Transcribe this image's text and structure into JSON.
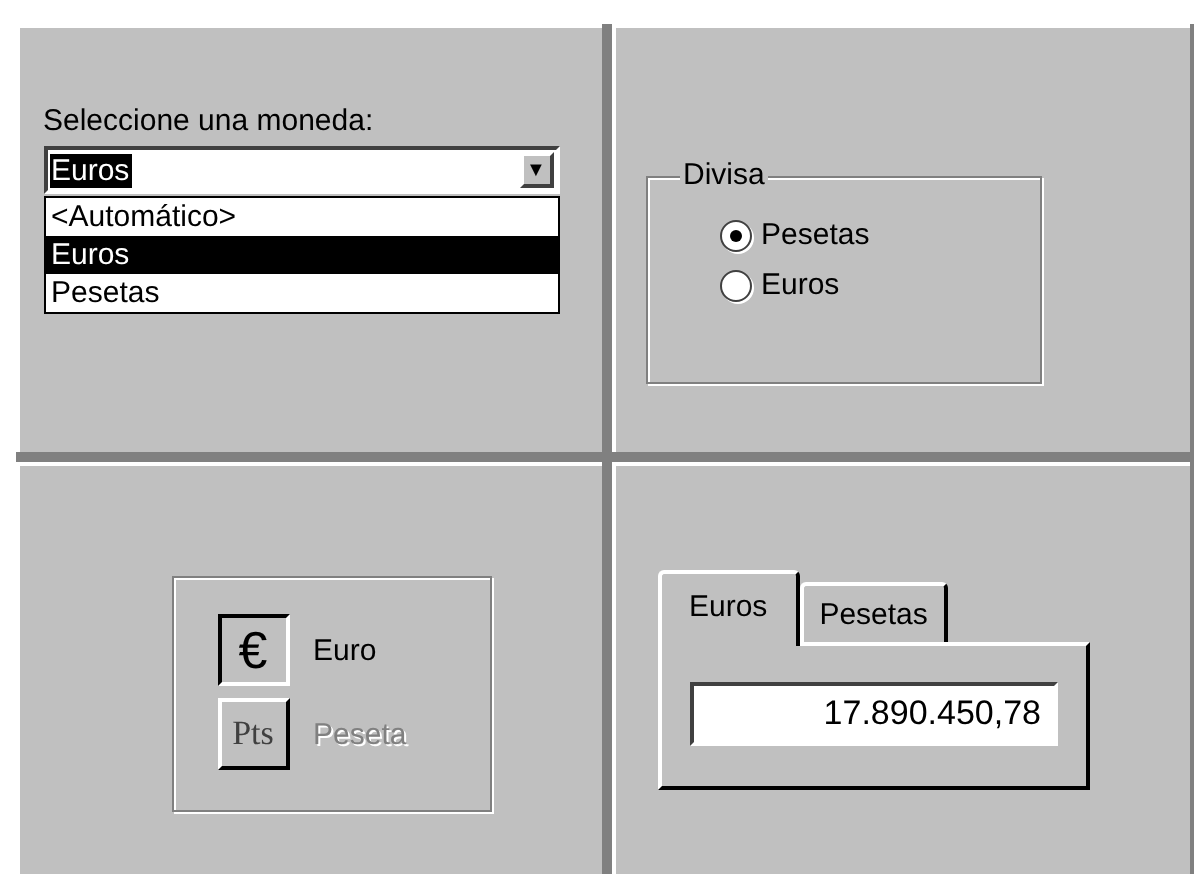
{
  "currency_combo": {
    "label": "Seleccione una moneda:",
    "value": "Euros",
    "arrow": "▼",
    "options": [
      {
        "label": "<Automático>",
        "selected": false
      },
      {
        "label": "Euros",
        "selected": true
      },
      {
        "label": "Pesetas",
        "selected": false
      }
    ]
  },
  "divisa_group": {
    "title": "Divisa",
    "options": [
      {
        "label": "Pesetas",
        "selected": true
      },
      {
        "label": "Euros",
        "selected": false
      }
    ]
  },
  "currency_buttons": [
    {
      "symbol": "€",
      "label": "Euro",
      "enabled": true
    },
    {
      "symbol": "Pts",
      "label": "Peseta",
      "enabled": false
    }
  ],
  "amount_tabs": {
    "tabs": [
      {
        "label": "Euros",
        "selected": true
      },
      {
        "label": "Pesetas",
        "selected": false
      }
    ],
    "value": "17.890.450,78"
  }
}
